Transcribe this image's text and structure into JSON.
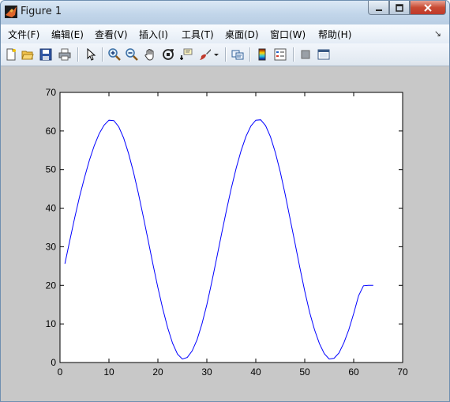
{
  "window": {
    "title": "Figure 1",
    "icon": "matlab-logo-icon",
    "controls": [
      "minimize-icon",
      "maximize-icon",
      "close-icon"
    ]
  },
  "menu": [
    {
      "label": "文件(F)",
      "name": "menu-file"
    },
    {
      "label": "编辑(E)",
      "name": "menu-edit"
    },
    {
      "label": "查看(V)",
      "name": "menu-view"
    },
    {
      "label": "插入(I)",
      "name": "menu-insert"
    },
    {
      "label": "工具(T)",
      "name": "menu-tools"
    },
    {
      "label": "桌面(D)",
      "name": "menu-desktop"
    },
    {
      "label": "窗口(W)",
      "name": "menu-window"
    },
    {
      "label": "帮助(H)",
      "name": "menu-help"
    }
  ],
  "menu_overflow": "↘",
  "toolbar": [
    "new-figure-icon",
    "open-file-icon",
    "save-icon",
    "print-icon",
    "edit-plot-arrow-icon",
    "zoom-in-icon",
    "zoom-out-icon",
    "pan-hand-icon",
    "rotate-3d-icon",
    "data-cursor-icon",
    "brush-icon",
    "brush-dropdown-icon",
    "link-plot-icon",
    "colorbar-icon",
    "legend-icon",
    "hide-plot-tools-icon",
    "show-plot-tools-icon"
  ],
  "colors": {
    "line": "#0000ff",
    "axes_bg": "#ffffff",
    "figure_bg": "#c8c8c8"
  },
  "chart_data": {
    "type": "line",
    "title": "",
    "xlabel": "",
    "ylabel": "",
    "xlim": [
      0,
      70
    ],
    "ylim": [
      0,
      70
    ],
    "xticks": [
      0,
      10,
      20,
      30,
      40,
      50,
      60,
      70
    ],
    "yticks": [
      0,
      10,
      20,
      30,
      40,
      50,
      60,
      70
    ],
    "grid": false,
    "series": [
      {
        "color": "#0000ff",
        "x": [
          1,
          2,
          3,
          4,
          5,
          6,
          7,
          8,
          9,
          10,
          11,
          12,
          13,
          14,
          15,
          16,
          17,
          18,
          19,
          20,
          21,
          22,
          23,
          24,
          25,
          26,
          27,
          28,
          29,
          30,
          31,
          32,
          33,
          34,
          35,
          36,
          37,
          38,
          39,
          40,
          41,
          42,
          43,
          44,
          45,
          46,
          47,
          48,
          49,
          50,
          51,
          52,
          53,
          54,
          55,
          56,
          57,
          58,
          59,
          60,
          61,
          62,
          63,
          64
        ],
        "y": [
          25.6,
          31.6,
          37.5,
          43.0,
          47.9,
          52.4,
          56.2,
          59.3,
          61.5,
          62.8,
          62.7,
          61.1,
          58.2,
          54.2,
          49.4,
          43.9,
          37.9,
          31.7,
          25.4,
          19.4,
          13.9,
          9.0,
          5.0,
          2.2,
          0.9,
          1.3,
          3.0,
          5.9,
          10.0,
          15.0,
          20.8,
          27.0,
          33.3,
          39.4,
          45.2,
          50.4,
          54.9,
          58.6,
          61.3,
          62.8,
          62.9,
          61.4,
          58.5,
          54.4,
          49.4,
          43.6,
          37.3,
          31.0,
          24.6,
          18.5,
          13.0,
          8.5,
          4.9,
          2.3,
          0.9,
          1.1,
          2.5,
          5.1,
          8.5,
          12.7,
          17.3,
          19.9,
          20.0,
          20.0
        ]
      }
    ]
  }
}
